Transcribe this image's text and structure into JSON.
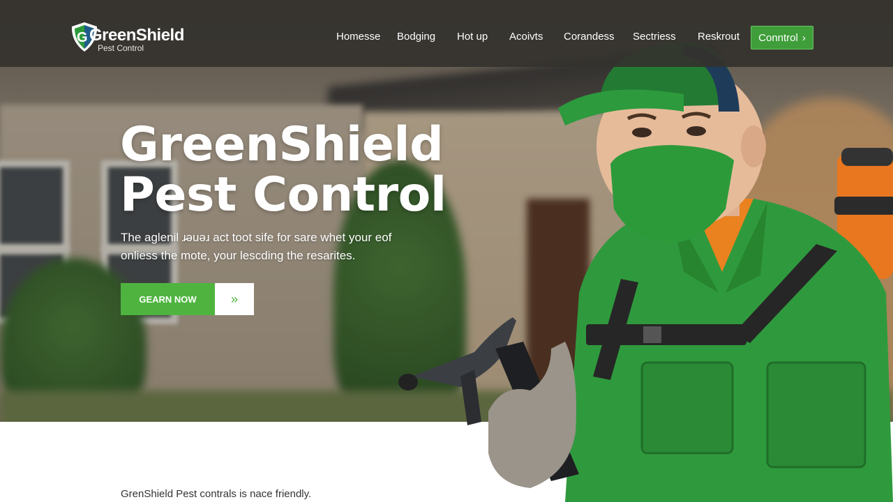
{
  "brand": {
    "name": "GreenShield",
    "sub": "Pest Control",
    "primary_green": "#4fb43f",
    "dark_green": "#2e7d32",
    "shield_icon": "shield-logo-icon"
  },
  "nav": {
    "items": [
      {
        "label": "Homesse"
      },
      {
        "label": "Bodging"
      },
      {
        "label": "Hot up"
      },
      {
        "label": "Acoivts"
      },
      {
        "label": "Corandess"
      },
      {
        "label": "Sectriess"
      },
      {
        "label": "Reskrout"
      }
    ],
    "cta_label": "Conntrol",
    "cta_icon": "chevron-right-icon"
  },
  "hero": {
    "title_line1": "GreenShield",
    "title_line2": "Pest Control",
    "desc_line1": "The aglenil ɹ̵ǝuǝɹ act toot sife for sare whet your eof",
    "desc_line2": "onliess the mote, your lescding the resarites.",
    "button_label": "GEARN NOW",
    "button_icon": "double-chevron-right-icon"
  },
  "lower": {
    "text": "GrenShield Pest contrals is nace friendly."
  }
}
